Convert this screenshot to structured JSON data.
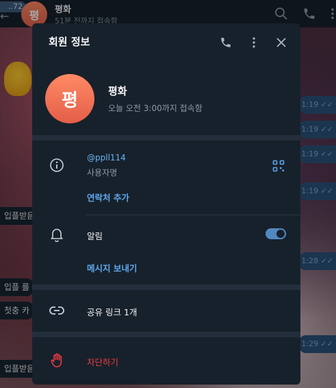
{
  "background": {
    "back_badge": "..72",
    "chat_avatar_letter": "평",
    "chat_name": "평화",
    "chat_status": "51분 전까지 접속함",
    "left_messages": [
      "입플받음",
      "입플 를",
      "첫충 카",
      "입플받음"
    ],
    "right_message_times": [
      "1:19",
      "1:19",
      "1:19",
      "1:19",
      "1:28",
      "1:29"
    ]
  },
  "modal": {
    "title": "회원 정보",
    "profile": {
      "avatar_letter": "평",
      "name": "평화",
      "status": "오늘 오전 3:00까지 접속함"
    },
    "info": {
      "username": "@ppll114",
      "username_label": "사용자명",
      "add_contact": "연락처 추가"
    },
    "notifications": {
      "label": "알림",
      "enabled": true,
      "send_message": "메시지 보내기"
    },
    "shared_links": "공유 링크 1개",
    "block": "차단하기"
  },
  "colors": {
    "accent": "#5ea8ee",
    "danger": "#ec3942",
    "panel": "#17212b",
    "separator": "#232e3c"
  },
  "icons": [
    "phone-icon",
    "more-vertical-icon",
    "close-icon",
    "info-icon",
    "qr-code-icon",
    "bell-icon",
    "link-icon",
    "hand-stop-icon",
    "search-icon"
  ]
}
